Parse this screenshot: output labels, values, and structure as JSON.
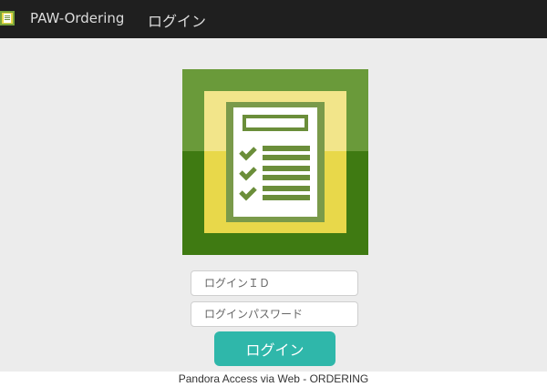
{
  "header": {
    "app_name": "PAW-Ordering",
    "nav_login": "ログイン",
    "icon": "app-logo-icon"
  },
  "logo": {
    "icon": "checklist-icon",
    "colors": {
      "outer_top": "#6a9a3a",
      "outer_bottom": "#3f7a12",
      "inner_top": "#f2e58a",
      "inner_bottom": "#e8d84a",
      "paper": "#ffffff",
      "mark": "#6b8e3a"
    }
  },
  "form": {
    "login_id_placeholder": "ログインＩＤ",
    "password_placeholder": "ログインパスワード",
    "submit_label": "ログイン"
  },
  "footer": {
    "text": "Pandora Access via Web - ORDERING"
  },
  "colors": {
    "topbar": "#1f1f1f",
    "background": "#ececec",
    "button": "#2fb7aa"
  }
}
